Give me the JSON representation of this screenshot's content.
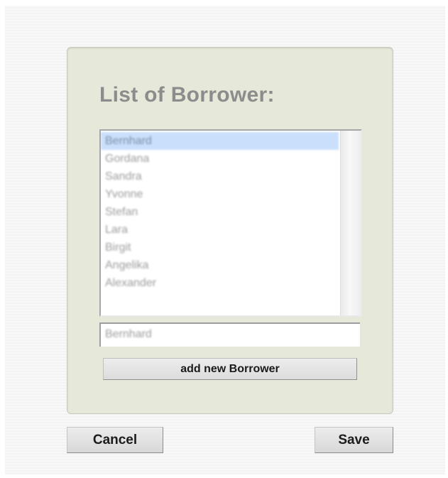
{
  "dialog": {
    "title": "List of Borrower:",
    "borrowers": [
      "Bernhard",
      "Gordana",
      "Sandra",
      "Yvonne",
      "Stefan",
      "Lara",
      "Birgit",
      "Angelika",
      "Alexander"
    ],
    "selected_index": 0,
    "name_field_value": "Bernhard",
    "add_button_label": "add new Borrower"
  },
  "footer": {
    "cancel_label": "Cancel",
    "save_label": "Save"
  },
  "colors": {
    "panel_bg": "#e6e8d9",
    "selection_bg": "#c9dffb",
    "title_text": "#8c8c8c"
  }
}
